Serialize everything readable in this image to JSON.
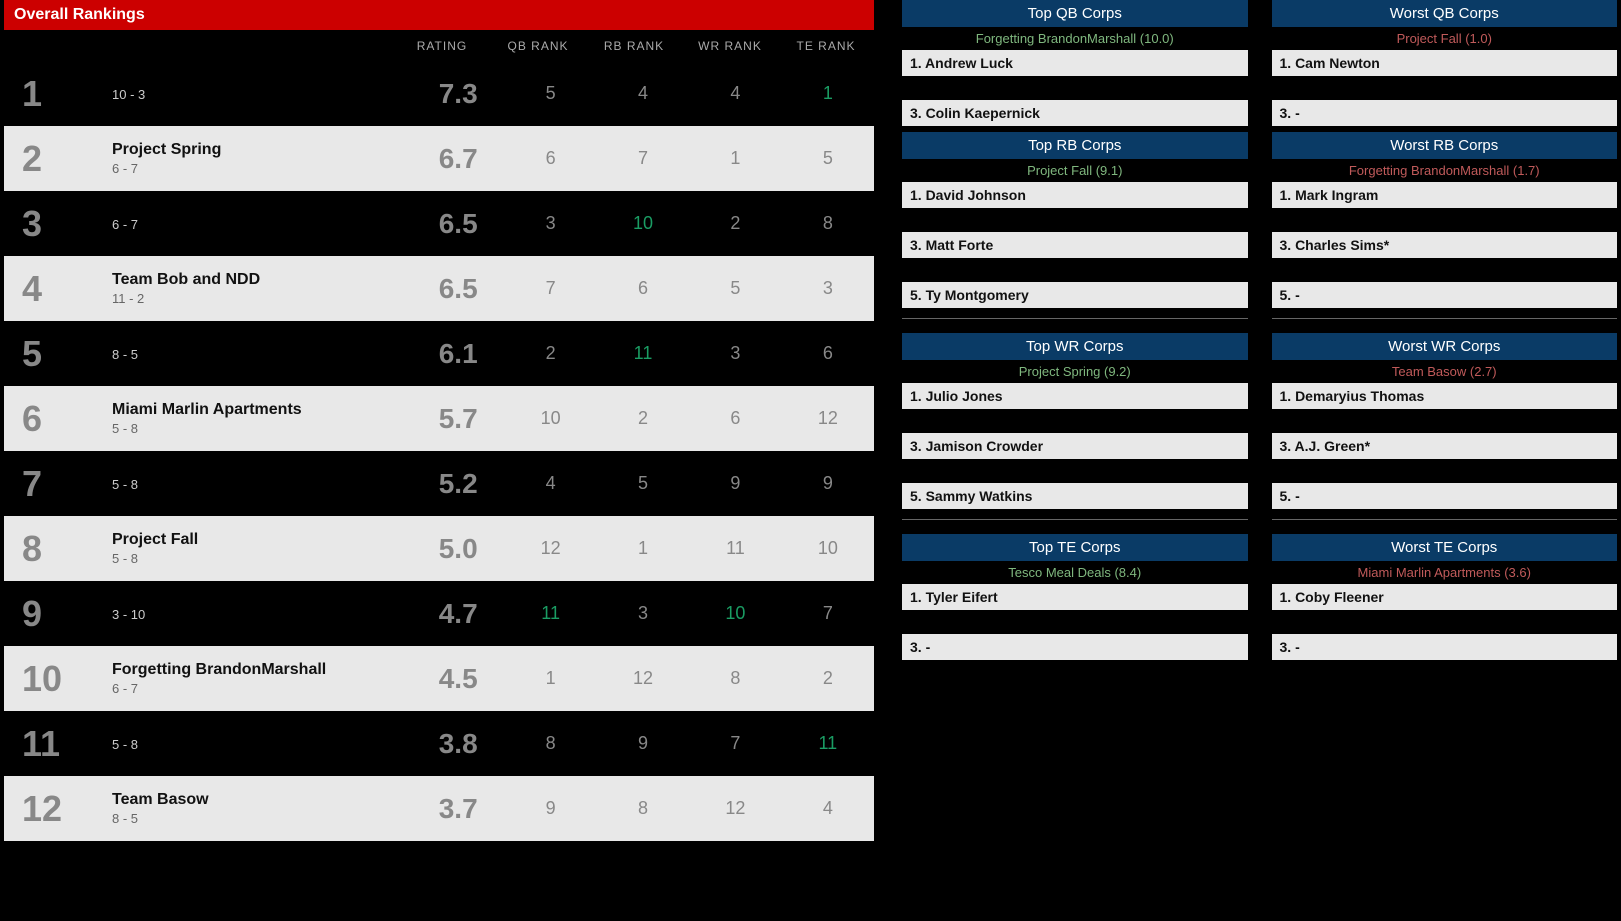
{
  "title": "Overall Rankings",
  "columns": [
    "RATING",
    "QB RANK",
    "RB RANK",
    "WR RANK",
    "TE RANK"
  ],
  "rows": [
    {
      "rank": "1",
      "team": "",
      "rec": "10 - 3",
      "rating": "7.3",
      "qb": "5",
      "rb": "4",
      "wr": "4",
      "te": "1",
      "teGreen": true
    },
    {
      "rank": "2",
      "team": "Project Spring",
      "rec": "6 - 7",
      "rating": "6.7",
      "qb": "6",
      "rb": "7",
      "wr": "1",
      "te": "5"
    },
    {
      "rank": "3",
      "team": "",
      "rec": "6 - 7",
      "rating": "6.5",
      "qb": "3",
      "rb": "10",
      "wr": "2",
      "te": "8",
      "rbGreen": true
    },
    {
      "rank": "4",
      "team": "Team Bob and NDD",
      "rec": "11 - 2",
      "rating": "6.5",
      "qb": "7",
      "rb": "6",
      "wr": "5",
      "te": "3"
    },
    {
      "rank": "5",
      "team": "",
      "rec": "8 - 5",
      "rating": "6.1",
      "qb": "2",
      "rb": "11",
      "wr": "3",
      "te": "6",
      "rbGreen": true
    },
    {
      "rank": "6",
      "team": "Miami Marlin Apartments",
      "rec": "5 - 8",
      "rating": "5.7",
      "qb": "10",
      "rb": "2",
      "wr": "6",
      "te": "12"
    },
    {
      "rank": "7",
      "team": "",
      "rec": "5 - 8",
      "rating": "5.2",
      "qb": "4",
      "rb": "5",
      "wr": "9",
      "te": "9"
    },
    {
      "rank": "8",
      "team": "Project Fall",
      "rec": "5 - 8",
      "rating": "5.0",
      "qb": "12",
      "rb": "1",
      "wr": "11",
      "te": "10"
    },
    {
      "rank": "9",
      "team": "",
      "rec": "3 - 10",
      "rating": "4.7",
      "qb": "11",
      "rb": "3",
      "wr": "10",
      "te": "7",
      "qbGreen": true,
      "wrGreen": true
    },
    {
      "rank": "10",
      "team": "Forgetting BrandonMarshall",
      "rec": "6 - 7",
      "rating": "4.5",
      "qb": "1",
      "rb": "12",
      "wr": "8",
      "te": "2"
    },
    {
      "rank": "11",
      "team": "",
      "rec": "5 - 8",
      "rating": "3.8",
      "qb": "8",
      "rb": "9",
      "wr": "7",
      "te": "11",
      "teGreen": true
    },
    {
      "rank": "12",
      "team": "Team Basow",
      "rec": "8 - 5",
      "rating": "3.7",
      "qb": "9",
      "rb": "8",
      "wr": "12",
      "te": "4"
    }
  ],
  "panels": {
    "topQB": {
      "title": "Top QB Corps",
      "sub": "Forgetting BrandonMarshall (10.0)",
      "items": [
        "1. Andrew Luck",
        "3. Colin Kaepernick"
      ]
    },
    "worstQB": {
      "title": "Worst QB Corps",
      "sub": "Project Fall (1.0)",
      "items": [
        "1. Cam Newton",
        "3. -"
      ]
    },
    "topRB": {
      "title": "Top RB Corps",
      "sub": "Project Fall (9.1)",
      "items": [
        "1. David Johnson",
        "3. Matt Forte",
        "5. Ty Montgomery"
      ]
    },
    "worstRB": {
      "title": "Worst RB Corps",
      "sub": "Forgetting BrandonMarshall (1.7)",
      "items": [
        "1. Mark Ingram",
        "3. Charles Sims*",
        "5. -"
      ]
    },
    "topWR": {
      "title": "Top WR Corps",
      "sub": "Project Spring (9.2)",
      "items": [
        "1. Julio Jones",
        "3. Jamison Crowder",
        "5. Sammy Watkins"
      ]
    },
    "worstWR": {
      "title": "Worst WR Corps",
      "sub": "Team Basow (2.7)",
      "items": [
        "1. Demaryius Thomas",
        "3. A.J. Green*",
        "5. -"
      ]
    },
    "topTE": {
      "title": "Top TE Corps",
      "sub": "Tesco Meal Deals (8.4)",
      "items": [
        "1. Tyler Eifert",
        "3. -"
      ]
    },
    "worstTE": {
      "title": "Worst TE Corps",
      "sub": "Miami Marlin Apartments (3.6)",
      "items": [
        "1. Coby Fleener",
        "3. -"
      ]
    }
  }
}
